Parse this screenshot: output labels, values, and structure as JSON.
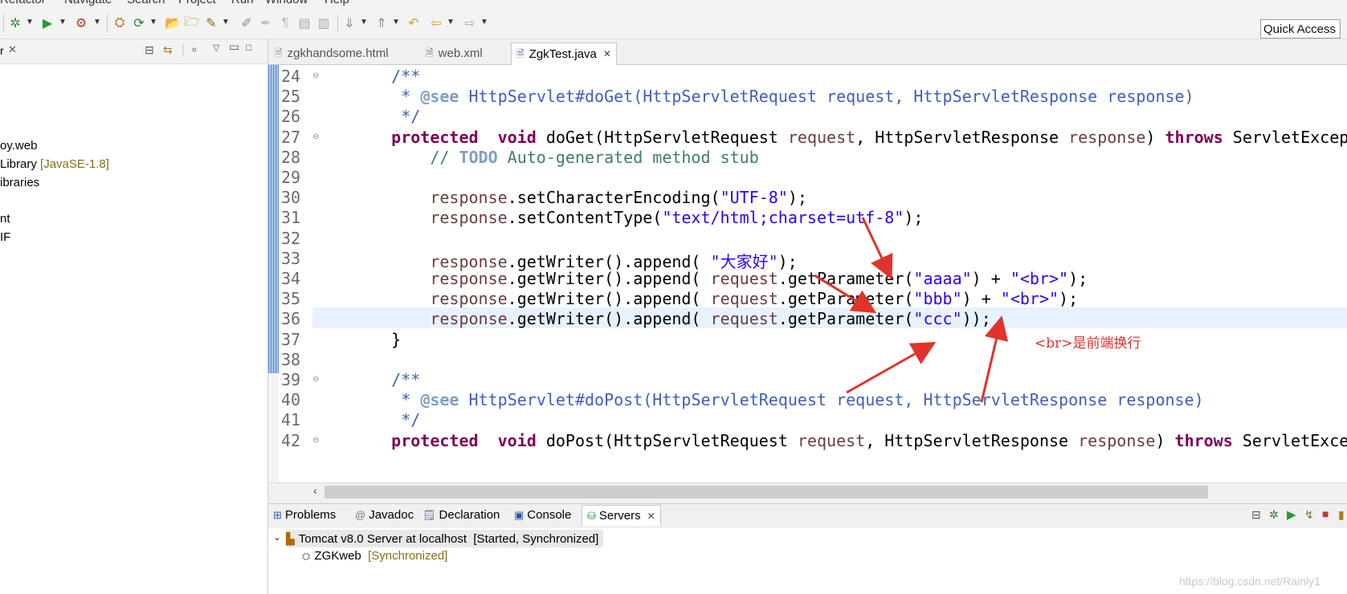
{
  "menu": [
    "Refactor",
    "Navigate",
    "Search",
    "Project",
    "Run",
    "Window",
    "Help"
  ],
  "toolbar": {
    "quick_access": "Quick Access"
  },
  "explorer": {
    "items": [
      {
        "label": "oy.web",
        "extra": ""
      },
      {
        "label": " Library",
        "extra": "[JavaSE-1.8]"
      },
      {
        "label": "ibraries",
        "extra": ""
      },
      {
        "label": "nt",
        "extra": ""
      },
      {
        "label": "IF",
        "extra": ""
      }
    ]
  },
  "editor": {
    "tabs": [
      {
        "label": "zgkhandsome.html",
        "active": false
      },
      {
        "label": "web.xml",
        "active": false
      },
      {
        "label": "ZgkTest.java",
        "active": true
      }
    ],
    "line_numbers": [
      "24",
      "25",
      "26",
      "27",
      "28",
      "29",
      "30",
      "31",
      "32",
      "33",
      "34",
      "35",
      "36",
      "37",
      "38",
      "39",
      "40",
      "41",
      "42"
    ],
    "lines": [
      {
        "indent": "    ",
        "parts": [
          [
            "cm",
            "/**"
          ]
        ]
      },
      {
        "indent": "     ",
        "parts": [
          [
            "cm",
            "* "
          ],
          [
            "cmb",
            "@see"
          ],
          [
            "cm",
            " HttpServlet#doGet(HttpServletRequest request, HttpServletResponse response)"
          ]
        ]
      },
      {
        "indent": "     ",
        "parts": [
          [
            "cm",
            "*/"
          ]
        ]
      },
      {
        "indent": "    ",
        "parts": [
          [
            "kw",
            "protected"
          ],
          [
            "",
            "  "
          ],
          [
            "kw",
            "void"
          ],
          [
            "",
            " doGet(HttpServletRequest "
          ],
          [
            "prm",
            "request"
          ],
          [
            "",
            ", HttpServletResponse "
          ],
          [
            "prm",
            "response"
          ],
          [
            "",
            ") "
          ],
          [
            "kw",
            "throws"
          ],
          [
            "",
            " ServletException, IOException {"
          ]
        ]
      },
      {
        "indent": "        ",
        "parts": [
          [
            "cm2",
            "// "
          ],
          [
            "todo",
            "TODO"
          ],
          [
            "cm2",
            " Auto-generated method stub"
          ]
        ]
      },
      {
        "indent": "",
        "parts": []
      },
      {
        "indent": "        ",
        "parts": [
          [
            "prm",
            "response"
          ],
          [
            "",
            ".setCharacterEncoding("
          ],
          [
            "str",
            "\"UTF-8\""
          ],
          [
            "",
            ");"
          ]
        ]
      },
      {
        "indent": "        ",
        "parts": [
          [
            "prm",
            "response"
          ],
          [
            "",
            ".setContentType("
          ],
          [
            "str",
            "\"text/html;charset=utf-8\""
          ],
          [
            "",
            ");"
          ]
        ]
      },
      {
        "indent": "",
        "parts": []
      },
      {
        "indent": "        ",
        "parts": [
          [
            "prm",
            "response"
          ],
          [
            "",
            ".getWriter().append( "
          ],
          [
            "str",
            "\"大家好\""
          ],
          [
            "",
            ");"
          ]
        ]
      },
      {
        "indent": "        ",
        "parts": [
          [
            "prm",
            "response"
          ],
          [
            "",
            ".getWriter().append( "
          ],
          [
            "prm",
            "request"
          ],
          [
            "",
            ".getParameter("
          ],
          [
            "str",
            "\"aaaa\""
          ],
          [
            "",
            ") + "
          ],
          [
            "str",
            "\"<br>\""
          ],
          [
            "",
            ");"
          ]
        ]
      },
      {
        "indent": "        ",
        "parts": [
          [
            "prm",
            "response"
          ],
          [
            "",
            ".getWriter().append( "
          ],
          [
            "prm",
            "request"
          ],
          [
            "",
            ".getParameter("
          ],
          [
            "str",
            "\"bbb\""
          ],
          [
            "",
            ") + "
          ],
          [
            "str",
            "\"<br>\""
          ],
          [
            "",
            ");"
          ]
        ]
      },
      {
        "indent": "        ",
        "parts": [
          [
            "prm",
            "response"
          ],
          [
            "",
            ".getWriter().append( "
          ],
          [
            "prm",
            "request"
          ],
          [
            "",
            ".getParameter("
          ],
          [
            "str",
            "\"ccc\""
          ],
          [
            "",
            "));"
          ]
        ]
      },
      {
        "indent": "    ",
        "parts": [
          [
            "",
            "}"
          ]
        ]
      },
      {
        "indent": "",
        "parts": []
      },
      {
        "indent": "    ",
        "parts": [
          [
            "cm",
            "/**"
          ]
        ]
      },
      {
        "indent": "     ",
        "parts": [
          [
            "cm",
            "* "
          ],
          [
            "cmb",
            "@see"
          ],
          [
            "cm",
            " HttpServlet#doPost(HttpServletRequest request, HttpServletResponse response)"
          ]
        ]
      },
      {
        "indent": "     ",
        "parts": [
          [
            "cm",
            "*/"
          ]
        ]
      },
      {
        "indent": "    ",
        "parts": [
          [
            "kw",
            "protected"
          ],
          [
            "",
            "  "
          ],
          [
            "kw",
            "void"
          ],
          [
            "",
            " doPost(HttpServletRequest "
          ],
          [
            "prm",
            "request"
          ],
          [
            "",
            ", HttpServletResponse "
          ],
          [
            "prm",
            "response"
          ],
          [
            "",
            ") "
          ],
          [
            "kw",
            "throws"
          ],
          [
            "",
            " ServletException, IOException {"
          ]
        ]
      }
    ]
  },
  "annotation": "<br>是前端换行",
  "panel": {
    "tabs": [
      "Problems",
      "Javadoc",
      "Declaration",
      "Console",
      "Servers"
    ],
    "server": {
      "name": "Tomcat v8.0 Server at localhost",
      "state": "[Started, Synchronized]"
    },
    "module": {
      "name": "ZGKweb",
      "state": "[Synchronized]"
    }
  },
  "watermark": "https://blog.csdn.net/Rainly1",
  "colors": {
    "keyword": "#7f0055",
    "string": "#2a00ff",
    "comment": "#3f5fbf",
    "arrow": "#e0332b"
  }
}
